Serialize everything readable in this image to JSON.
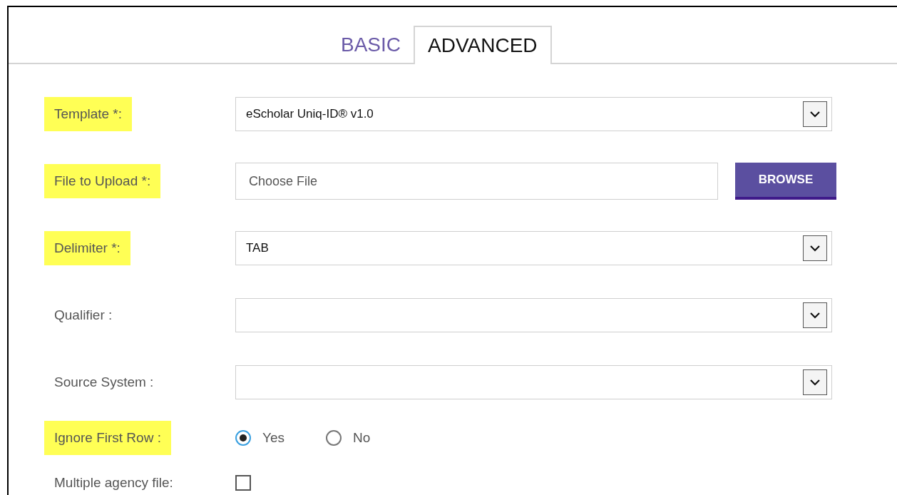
{
  "tabs": [
    {
      "label": "BASIC",
      "selected": false
    },
    {
      "label": "ADVANCED",
      "selected": true
    }
  ],
  "form": [
    {
      "kind": "select",
      "label": "Template *:",
      "highlighted": true,
      "value": "eScholar Uniq-ID® v1.0"
    },
    {
      "kind": "file",
      "label": "File to Upload *:",
      "highlighted": true,
      "placeholder": "Choose File",
      "button": "BROWSE"
    },
    {
      "kind": "select",
      "label": "Delimiter *:",
      "highlighted": true,
      "value": "TAB"
    },
    {
      "kind": "select",
      "label": "Qualifier :",
      "highlighted": false
    },
    {
      "kind": "select",
      "label": "Source System :",
      "highlighted": false
    },
    {
      "kind": "radio",
      "label": "Ignore First Row :",
      "highlighted": true,
      "options": [
        {
          "label": "Yes",
          "selected": true
        },
        {
          "label": "No",
          "selected": false
        }
      ]
    },
    {
      "kind": "checkbox",
      "label": "Multiple agency file:",
      "highlighted": false,
      "checked": false
    }
  ]
}
